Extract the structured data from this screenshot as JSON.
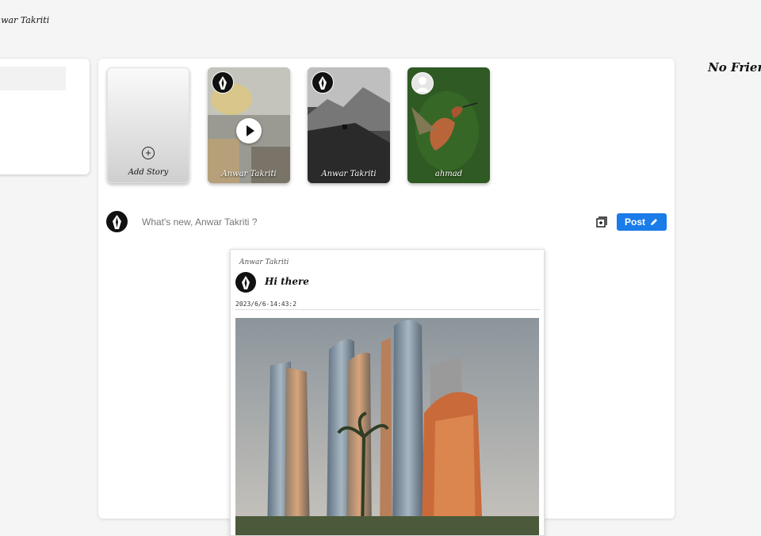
{
  "header": {
    "user_name": "nwar Takriti"
  },
  "right_sidebar": {
    "no_friends_text": "No Friends"
  },
  "stories": {
    "add_label": "Add Story",
    "items": [
      {
        "name": "Anwar Takriti",
        "kind": "video"
      },
      {
        "name": "Anwar Takriti",
        "kind": "image"
      },
      {
        "name": "ahmad",
        "kind": "image"
      }
    ]
  },
  "composer": {
    "placeholder": "What's new, Anwar Takriti ?",
    "post_label": "Post",
    "icons": {
      "media": "add-media-icon",
      "edit": "pencil-icon"
    }
  },
  "post": {
    "author": "Anwar Takriti",
    "text": "Hi there",
    "timestamp": "2023/6/6-14:43:2"
  },
  "colors": {
    "accent": "#1a7ce8",
    "background": "#f5f5f5"
  }
}
